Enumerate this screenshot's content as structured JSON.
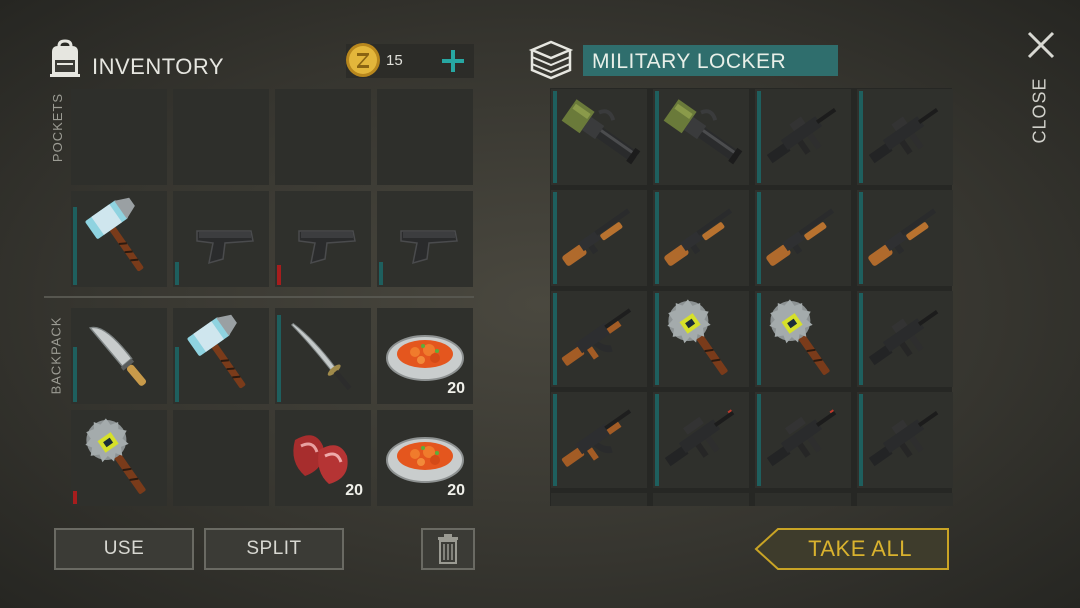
{
  "inventory": {
    "title": "INVENTORY",
    "coins": "15",
    "pockets_label": "POCKETS",
    "backpack_label": "BACKPACK",
    "pockets": [
      {
        "item": "",
        "qty": "",
        "bar": null
      },
      {
        "item": "",
        "qty": "",
        "bar": null
      },
      {
        "item": "",
        "qty": "",
        "bar": null
      },
      {
        "item": "",
        "qty": "",
        "bar": null
      },
      {
        "item": "hammer",
        "qty": "",
        "bar": {
          "level": 0.85,
          "color": "#1e5f5e"
        }
      },
      {
        "item": "pistol",
        "qty": "",
        "bar": {
          "level": 0.25,
          "color": "#1e5f5e"
        }
      },
      {
        "item": "pistol",
        "qty": "",
        "bar": {
          "level": 0.22,
          "color": "#a61d1d"
        }
      },
      {
        "item": "pistol",
        "qty": "",
        "bar": {
          "level": 0.25,
          "color": "#1e5f5e"
        }
      }
    ],
    "backpack": [
      {
        "item": "machete",
        "qty": "",
        "bar": {
          "level": 0.6,
          "color": "#1e5f5e"
        }
      },
      {
        "item": "hammer",
        "qty": "",
        "bar": {
          "level": 0.6,
          "color": "#1e5f5e"
        }
      },
      {
        "item": "katana",
        "qty": "",
        "bar": {
          "level": 0.95,
          "color": "#1e5f5e"
        }
      },
      {
        "item": "food-bowl",
        "qty": "20",
        "bar": null
      },
      {
        "item": "saw-mace",
        "qty": "",
        "bar": {
          "level": 0.14,
          "color": "#a61d1d"
        }
      },
      {
        "item": "",
        "qty": "",
        "bar": null
      },
      {
        "item": "raw-meat",
        "qty": "20",
        "bar": null
      },
      {
        "item": "food-bowl",
        "qty": "20",
        "bar": null
      }
    ]
  },
  "locker": {
    "title": "MILITARY LOCKER",
    "slots": [
      "minigun",
      "minigun",
      "m4-rifle",
      "m4-rifle",
      "shotgun",
      "shotgun",
      "shotgun",
      "shotgun",
      "ak-rifle",
      "saw-mace",
      "saw-mace",
      "m4-rifle",
      "ak-rifle",
      "m4-rifle-scoped",
      "m4-rifle-scoped",
      "m4-rifle"
    ]
  },
  "buttons": {
    "use": "USE",
    "split": "SPLIT",
    "take_all": "TAKE ALL",
    "close": "CLOSE"
  },
  "colors": {
    "accent_teal": "#2f6e6d",
    "plus_teal": "#27a7a2",
    "gold": "#c9a425",
    "durability_red": "#a61d1d"
  }
}
